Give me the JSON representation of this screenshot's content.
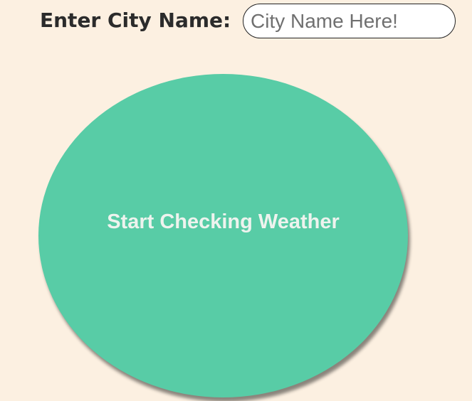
{
  "city_form": {
    "label": "Enter City Name:",
    "input_value": "",
    "input_placeholder": "City Name Here!"
  },
  "weather_button": {
    "label": "Start Checking Weather"
  },
  "colors": {
    "background": "#fcf0e1",
    "button": "#58cca6",
    "button_text": "#eef3ee",
    "label_text": "#2b2b2b"
  }
}
